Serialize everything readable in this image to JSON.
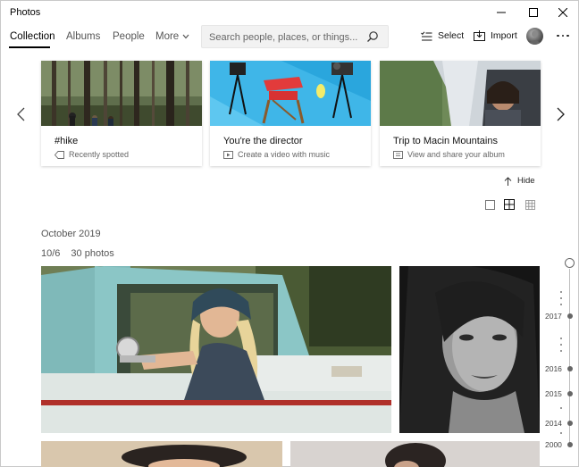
{
  "window": {
    "title": "Photos"
  },
  "nav": {
    "tabs": [
      {
        "label": "Collection",
        "active": true
      },
      {
        "label": "Albums",
        "active": false
      },
      {
        "label": "People",
        "active": false
      },
      {
        "label": "More",
        "active": false
      }
    ],
    "search_placeholder": "Search people, places, or things...",
    "select_label": "Select",
    "import_label": "Import"
  },
  "carousel": {
    "cards": [
      {
        "title": "#hike",
        "subtitle": "Recently spotted",
        "icon": "tag-icon"
      },
      {
        "title": "You're the director",
        "subtitle": "Create a video with music",
        "icon": "video-icon"
      },
      {
        "title": "Trip to Macin Mountains",
        "subtitle": "View and share your album",
        "icon": "album-icon"
      }
    ],
    "hide_label": "Hide"
  },
  "view_modes": [
    "single-view-icon",
    "medium-grid-icon",
    "small-grid-icon"
  ],
  "collection": {
    "month": "October 2019",
    "date": "10/6",
    "count": "30 photos"
  },
  "timeline": {
    "years": [
      "2017",
      "2016",
      "2015",
      "2014",
      "2000"
    ]
  },
  "colors": {
    "accent": "#000000",
    "card_shadow": "#d0d0d0",
    "text_secondary": "#555555"
  }
}
